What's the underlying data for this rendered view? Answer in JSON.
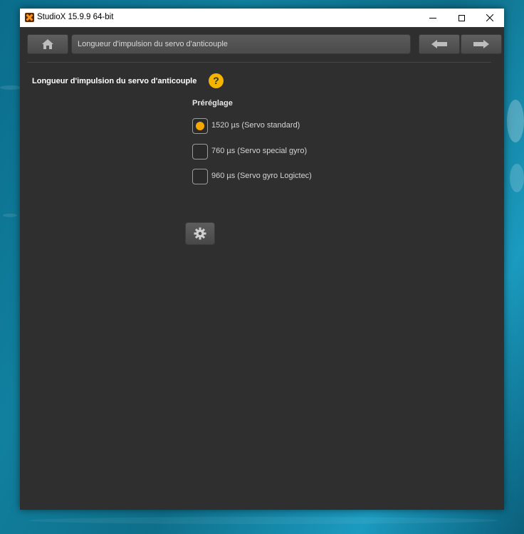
{
  "window": {
    "title": "StudioX 15.9.9  64-bit",
    "controls": [
      "minimize",
      "maximize",
      "close"
    ]
  },
  "navbar": {
    "breadcrumb": "Longueur d'impulsion du servo d'anticouple",
    "icons": [
      "home-icon",
      "arrow-left-icon",
      "arrow-right-icon"
    ]
  },
  "content": {
    "title": "Longueur d'impulsion du servo d'anticouple",
    "help_symbol": "?",
    "preset_label": "Préréglage",
    "options": [
      {
        "label": "1520 µs (Servo standard)",
        "selected": true
      },
      {
        "label": "760 µs (Servo special gyro)",
        "selected": false
      },
      {
        "label": "960 µs (Servo gyro Logictec)",
        "selected": false
      }
    ],
    "settings_icon": "gear-icon"
  },
  "colors": {
    "accent": "#f7a800",
    "panel": "#2f2f2f",
    "button": "#525252"
  }
}
